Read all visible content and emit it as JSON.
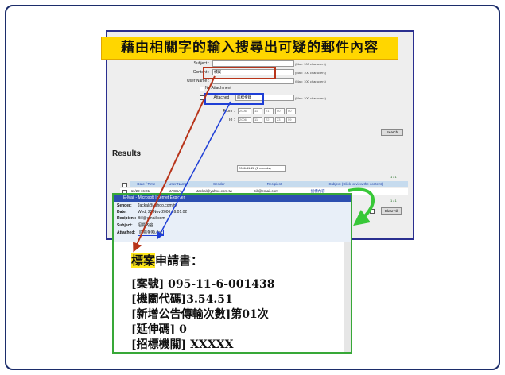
{
  "banner_text": "藉由相關字的輸入搜尋出可疑的郵件內容",
  "form": {
    "subject_label": "Subject :",
    "content_label": "Content :",
    "content_value": "標案",
    "username_label": "User Name :",
    "no_attachment_label": "No Attachment",
    "attached_label": "Attached :",
    "attached_value": "底標金額",
    "hint": "(Max: 100 characters)",
    "from_label": "From :",
    "to_label": "To :",
    "from_values": [
      "2006",
      "11",
      "21",
      "00",
      "00"
    ],
    "to_values": [
      "2006",
      "11",
      "22",
      "23",
      "59"
    ],
    "search_button": "Search"
  },
  "results": {
    "title": "Results",
    "date_select": "2006-11-22 (1 records)",
    "count_top": "1 / 1",
    "count_bottom": "1 / 1",
    "columns": [
      "Date / Time",
      "User Name",
      "Sender",
      "Recipient",
      "Subject (Click to view the content)"
    ],
    "row": [
      "11/22 16:01",
      "JACKAL",
      "Jackal@yahoo.com.tw",
      "Bill@email.com",
      "招標內容"
    ],
    "clear_all": "Clear All"
  },
  "email": {
    "window_title": "E-Mail - Microsoft Internet Explorer",
    "sender_label": "Sender:",
    "sender_value": "Jackal@yahoo.com.tw",
    "date_label": "Date:",
    "date_value": "Wed, 22 Nov 2006 16:01:02",
    "recipient_label": "Recipient:",
    "recipient_value": "Bill@email.com",
    "subject_label": "Subject:",
    "subject_value": "招標內容",
    "attached_label": "Attached:",
    "attached_value": "底標金額.doc",
    "title_hl": "標案",
    "title_rest": "申請書：",
    "lines": [
      "[案號] 095-11-6-001438",
      "[機關代碼]3.54.51",
      "[新增公告傳輸次數]第01次",
      "[延伸碼] 0",
      "[招標機關] XXXXX"
    ]
  },
  "colors": {
    "banner": "#ffd600",
    "red_marker": "#b8341a",
    "blue_marker": "#1f3fd6",
    "green_frame": "#38a838"
  }
}
